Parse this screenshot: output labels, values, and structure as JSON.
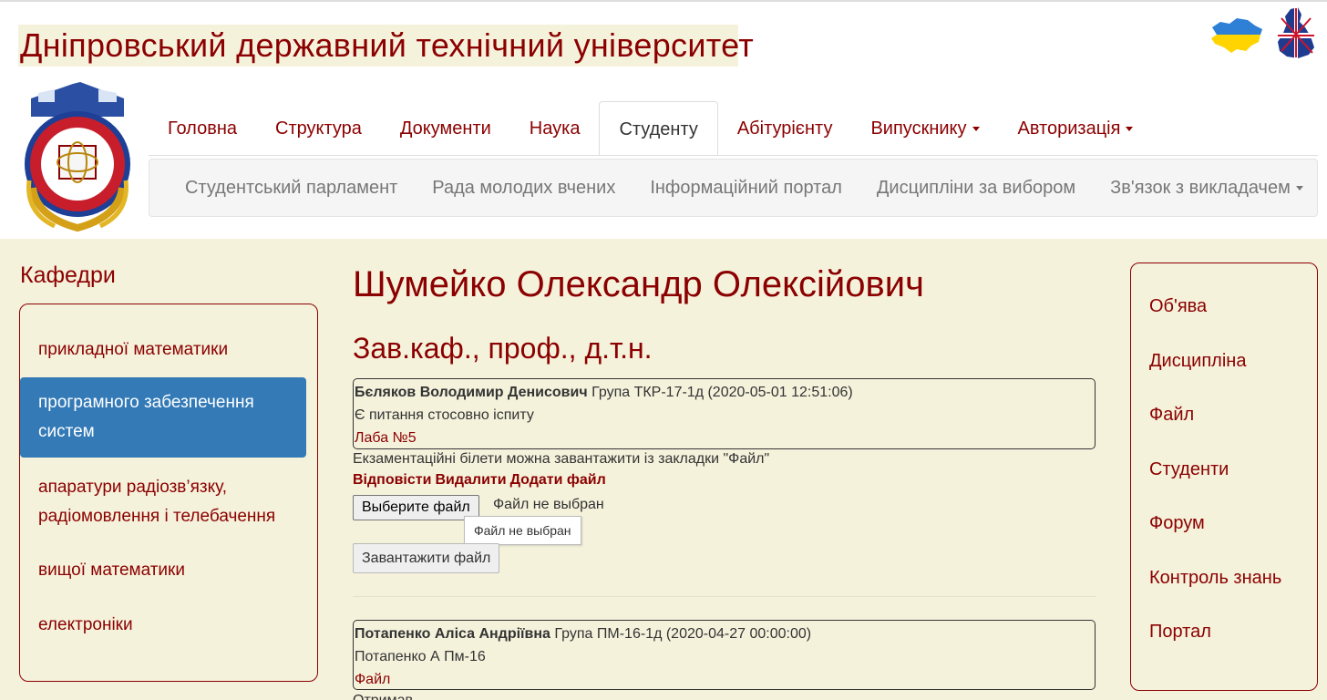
{
  "header": {
    "title": "Дніпровський державний технічний університет",
    "flags": [
      "ukraine-flag-icon",
      "uk-flag-icon"
    ]
  },
  "main_nav": [
    {
      "label": "Головна"
    },
    {
      "label": "Структура"
    },
    {
      "label": "Документи"
    },
    {
      "label": "Наука"
    },
    {
      "label": "Студенту",
      "active": true
    },
    {
      "label": "Абітурієнту"
    },
    {
      "label": "Випускнику",
      "dropdown": true
    },
    {
      "label": "Авторизація",
      "dropdown": true
    }
  ],
  "sub_nav": [
    {
      "label": "Студентський парламент"
    },
    {
      "label": "Рада молодих вчених"
    },
    {
      "label": "Інформаційний портал"
    },
    {
      "label": "Дисципліни за вибором"
    },
    {
      "label": "Зв'язок з викладачем",
      "dropdown": true
    }
  ],
  "left_sidebar": {
    "title": "Кафедри",
    "items": [
      {
        "label": "прикладної математики"
      },
      {
        "label": "програмного забезпечення систем",
        "active": true
      },
      {
        "label": "апаратури радіозв’язку, радіомовлення і телебачення"
      },
      {
        "label": "вищої математики"
      },
      {
        "label": "електроніки"
      }
    ]
  },
  "right_sidebar": {
    "items": [
      "Об'ява",
      "Дисципліна",
      "Файл",
      "Студенти",
      "Форум",
      "Контроль знань",
      "Портал"
    ]
  },
  "person": {
    "name": "Шумейко Олександр Олексійович",
    "position": "Зав.каф., проф., д.т.н."
  },
  "messages": [
    {
      "author": "Бєляков Володимир Денисович",
      "meta": " Група ТКР-17-1д (2020-05-01 12:51:06)",
      "text": "Є питання стосовно іспиту",
      "link": "Лаба №5"
    },
    {
      "author": "Потапенко Аліса Андріївна",
      "meta": " Група ПМ-16-1д (2020-04-27 00:00:00)",
      "text": "Потапенко А Пм-16",
      "link": "Файл"
    }
  ],
  "reply": {
    "text": "Екзаментаційні білети можна завантажити із закладки \"Файл\"",
    "actions": [
      "Відповісти",
      "Видалити",
      "Додати файл"
    ],
    "file_button": "Выберите файл",
    "file_status": "Файл не выбран",
    "tooltip": "Файл не выбран",
    "upload_button": "Завантажити файл"
  },
  "partial_text": "Отримав"
}
